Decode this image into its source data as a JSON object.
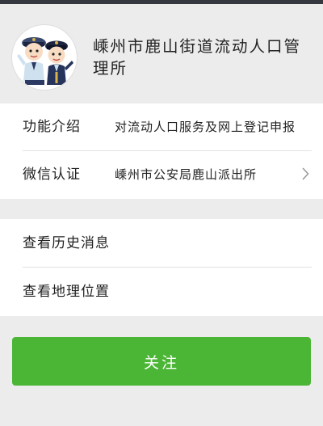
{
  "profile": {
    "account_name": "嵊州市鹿山街道流动人口管理所"
  },
  "info_rows": [
    {
      "label": "功能介绍",
      "value": "对流动人口服务及网上登记申报"
    },
    {
      "label": "微信认证",
      "value": "嵊州市公安局鹿山派出所"
    }
  ],
  "action_rows": [
    {
      "label": "查看历史消息"
    },
    {
      "label": "查看地理位置"
    }
  ],
  "follow_button": {
    "label": "关注",
    "color": "#4bb635"
  },
  "icons": {
    "avatar": "police-officers-cartoon-icon",
    "arrow": "chevron-right-icon"
  },
  "colors": {
    "background": "#ececec",
    "status_bar": "#35383e",
    "text": "#222222"
  }
}
